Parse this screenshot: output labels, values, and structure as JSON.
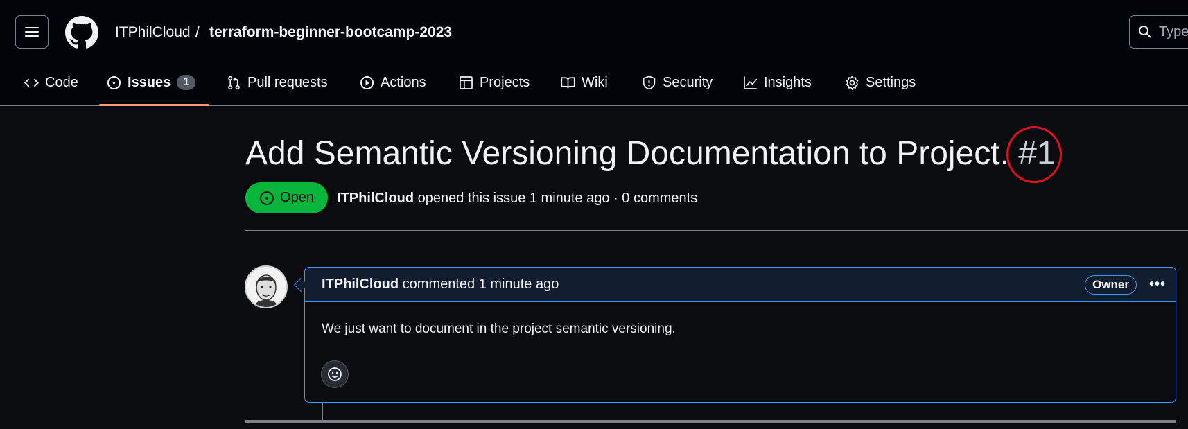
{
  "header": {
    "owner": "ITPhilCloud",
    "separator": "/",
    "repo": "terraform-beginner-bootcamp-2023",
    "search_placeholder": "Type"
  },
  "nav": [
    {
      "label": "Code",
      "icon": "code-icon"
    },
    {
      "label": "Issues",
      "icon": "issue-opened-icon",
      "count": "1",
      "active": true
    },
    {
      "label": "Pull requests",
      "icon": "git-pull-request-icon"
    },
    {
      "label": "Actions",
      "icon": "play-icon"
    },
    {
      "label": "Projects",
      "icon": "table-icon"
    },
    {
      "label": "Wiki",
      "icon": "book-icon"
    },
    {
      "label": "Security",
      "icon": "shield-icon"
    },
    {
      "label": "Insights",
      "icon": "graph-icon"
    },
    {
      "label": "Settings",
      "icon": "gear-icon"
    }
  ],
  "issue": {
    "title": "Add Semantic Versioning Documentation to Project.",
    "number": "#1",
    "state": "Open",
    "author": "ITPhilCloud",
    "meta": "opened this issue 1 minute ago · 0 comments",
    "state_color": "#09b43a",
    "annotation_color": "#e0121f"
  },
  "comment": {
    "author": "ITPhilCloud",
    "meta": "commented 1 minute ago",
    "role": "Owner",
    "menu": "•••",
    "body": "We just want to document in the project semantic versioning.",
    "accent": "#4493f8"
  }
}
